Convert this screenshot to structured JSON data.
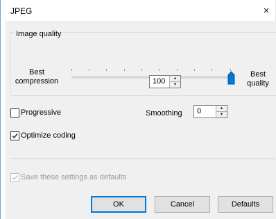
{
  "window": {
    "title": "JPEG",
    "close_glyph": "×"
  },
  "image_quality": {
    "group_label": "Image quality",
    "left_label_line1": "Best",
    "left_label_line2": "compression",
    "right_label_line1": "Best",
    "right_label_line2": "quality",
    "slider_value": 100,
    "slider_min": 0,
    "slider_max": 100,
    "quality_value": "100"
  },
  "options": {
    "progressive_label": "Progressive",
    "progressive_checked": false,
    "smoothing_label": "Smoothing",
    "smoothing_value": "0",
    "optimize_label": "Optimize coding",
    "optimize_checked": true,
    "save_defaults_label": "Save these settings as defaults",
    "save_defaults_checked": true,
    "save_defaults_enabled": false
  },
  "buttons": {
    "ok": "OK",
    "cancel": "Cancel",
    "defaults": "Defaults"
  },
  "colors": {
    "accent": "#0078d7",
    "dialog_bg": "#f0f0f0"
  }
}
